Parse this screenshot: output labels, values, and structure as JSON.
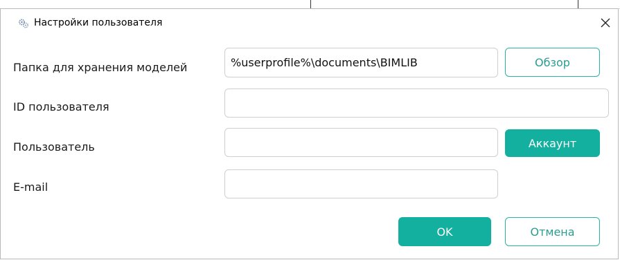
{
  "dialog": {
    "title": "Настройки пользователя",
    "icons": {
      "app": "gears-icon",
      "close": "close-icon"
    }
  },
  "fields": {
    "folder": {
      "label": "Папка для хранения моделей",
      "value": "%userprofile%\\documents\\BIMLIB"
    },
    "user_id": {
      "label": "ID пользователя",
      "value": ""
    },
    "user": {
      "label": "Пользователь",
      "value": ""
    },
    "email": {
      "label": "E-mail",
      "value": ""
    }
  },
  "buttons": {
    "browse": "Обзор",
    "account": "Аккаунт",
    "ok": "OK",
    "cancel": "Отмена"
  },
  "colors": {
    "accent": "#13b09f",
    "accent_border": "#2ab3a3"
  }
}
